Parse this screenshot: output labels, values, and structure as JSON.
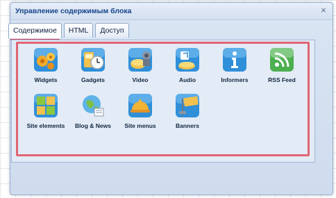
{
  "dialog": {
    "title": "Управление содержимым блока",
    "close_label": "×"
  },
  "tabs": [
    {
      "label": "Содержимое",
      "active": true
    },
    {
      "label": "HTML",
      "active": false
    },
    {
      "label": "Доступ",
      "active": false
    }
  ],
  "items": [
    {
      "label": "Widgets",
      "icon": "widgets-icon"
    },
    {
      "label": "Gadgets",
      "icon": "gadgets-icon"
    },
    {
      "label": "Video",
      "icon": "video-icon"
    },
    {
      "label": "Audio",
      "icon": "audio-icon"
    },
    {
      "label": "Informers",
      "icon": "informers-icon"
    },
    {
      "label": "RSS Feed",
      "icon": "rss-feed-icon"
    },
    {
      "label": "Site elements",
      "icon": "site-elements-icon"
    },
    {
      "label": "Blog & News",
      "icon": "blog-news-icon"
    },
    {
      "label": "Site menus",
      "icon": "site-menus-icon"
    },
    {
      "label": "Banners",
      "icon": "banners-icon"
    }
  ],
  "colors": {
    "title_text": "#15428b",
    "highlight_border": "#e06473",
    "icon_tile": "#2f8fd9"
  }
}
